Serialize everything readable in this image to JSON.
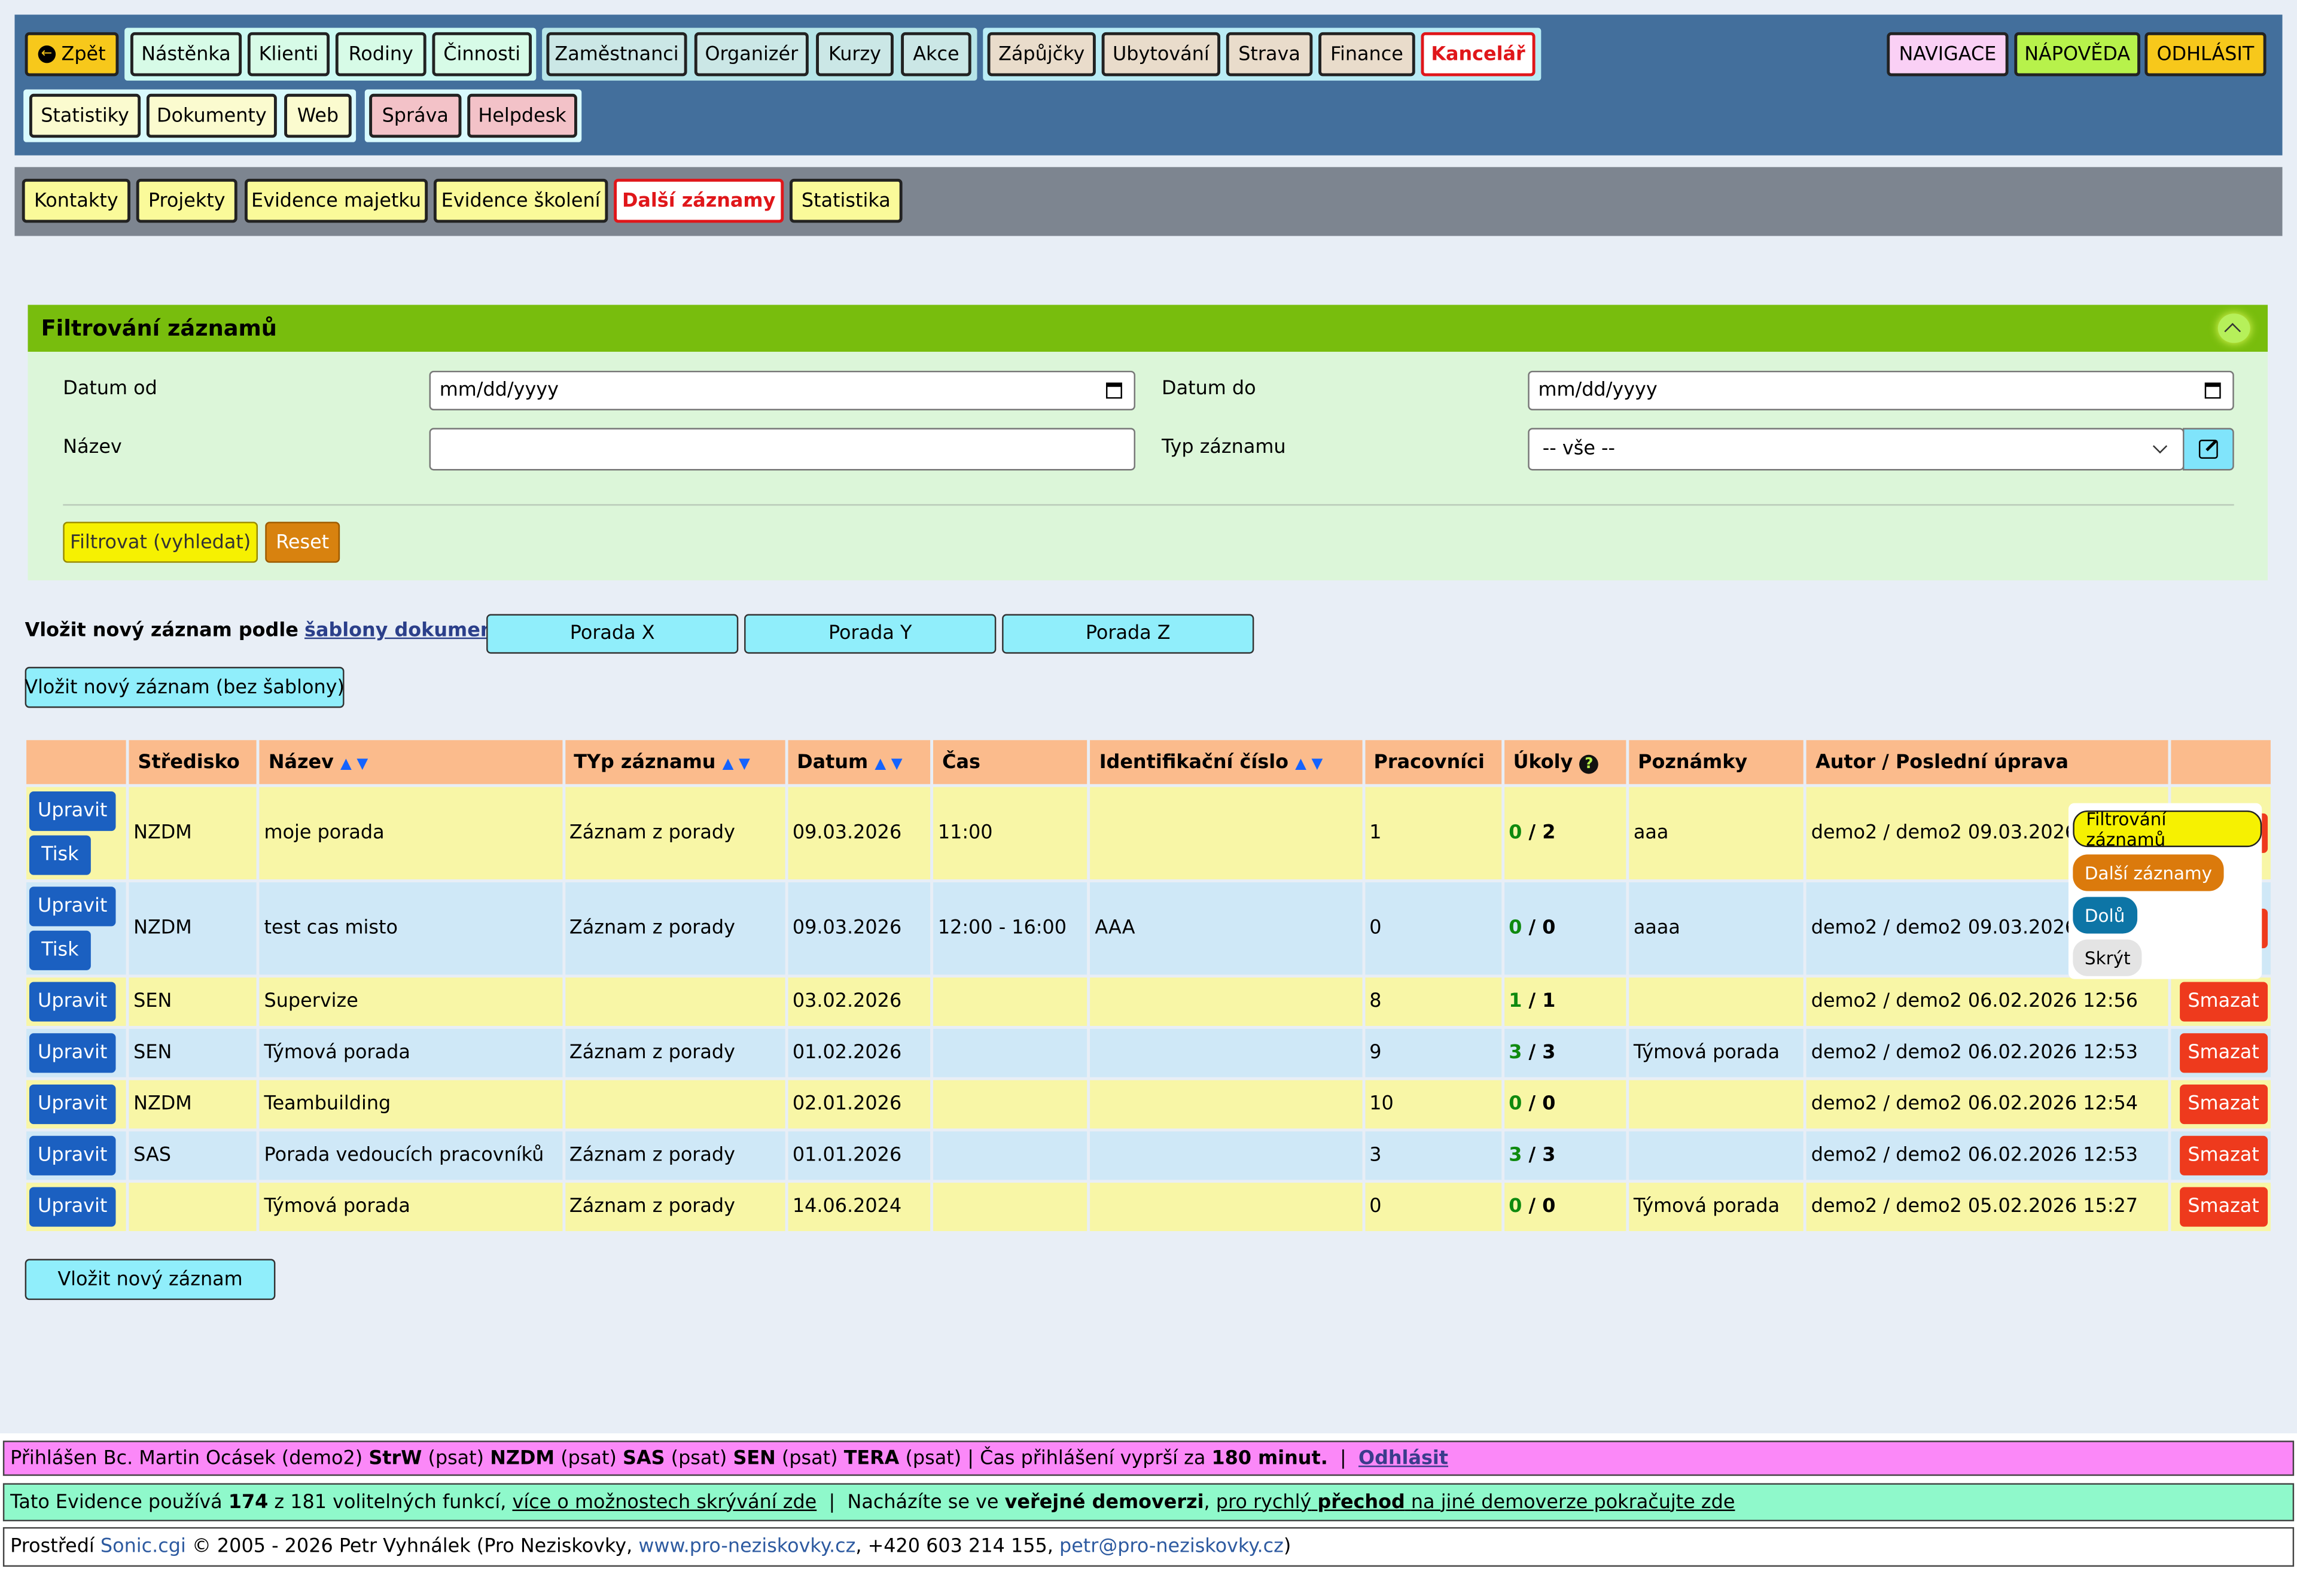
{
  "nav": {
    "back": "Zpět",
    "group1": [
      "Nástěnka",
      "Klienti",
      "Rodiny",
      "Činnosti"
    ],
    "group2": [
      "Zaměstnanci",
      "Organizér",
      "Kurzy",
      "Akce"
    ],
    "group3": [
      "Zápůjčky",
      "Ubytování",
      "Strava",
      "Finance"
    ],
    "active": "Kancelář",
    "group4": [
      "Statistiky",
      "Dokumenty",
      "Web"
    ],
    "group5": [
      "Správa",
      "Helpdesk"
    ],
    "right": [
      "NAVIGACE",
      "NÁPOVĚDA",
      "ODHLÁSIT"
    ]
  },
  "subnav": {
    "items": [
      "Kontakty",
      "Projekty",
      "Evidence majetku",
      "Evidence školení"
    ],
    "active": "Další záznamy",
    "last": "Statistika"
  },
  "filter": {
    "title": "Filtrování záznamů",
    "date_from_label": "Datum od",
    "date_to_label": "Datum do",
    "date_placeholder": "mm/dd/yyyy",
    "name_label": "Název",
    "type_label": "Typ záznamu",
    "type_value": "-- vše --",
    "filter_button": "Filtrovat (vyhledat)",
    "reset_button": "Reset"
  },
  "templates": {
    "prefix": "Vložit nový záznam podle",
    "link": "šablony dokumentů",
    "suffix": ":",
    "buttons": [
      "Porada X",
      "Porada Y",
      "Porada Z"
    ],
    "no_template": "Vložit nový záznam (bez šablony)"
  },
  "table": {
    "headers": [
      "",
      "Středisko",
      "Název",
      "TYp záznamu",
      "Datum",
      "Čas",
      "Identifikační číslo",
      "Pracovníci",
      "Úkoly",
      "Poznámky",
      "Autor / Poslední úprava",
      ""
    ],
    "edit": "Upravit",
    "print": "Tisk",
    "delete": "Smazat",
    "rows": [
      {
        "stredisko": "NZDM",
        "nazev": "moje porada",
        "typ": "Záznam z porady",
        "datum": "09.03.2026",
        "cas": "11:00",
        "id": "",
        "prac": "1",
        "done": "0",
        "total": "2",
        "pozn": "aaa",
        "autor": "demo2 / demo2 09.03.2026 0",
        "print": true
      },
      {
        "stredisko": "NZDM",
        "nazev": "test cas misto",
        "typ": "Záznam z porady",
        "datum": "09.03.2026",
        "cas": "12:00 - 16:00",
        "id": "AAA",
        "prac": "0",
        "done": "0",
        "total": "0",
        "pozn": "aaaa",
        "autor": "demo2 / demo2 09.03.2026 0",
        "print": true
      },
      {
        "stredisko": "SEN",
        "nazev": "Supervize",
        "typ": "",
        "datum": "03.02.2026",
        "cas": "",
        "id": "",
        "prac": "8",
        "done": "1",
        "total": "1",
        "pozn": "",
        "autor": "demo2 / demo2 06.02.2026 12:56",
        "print": false
      },
      {
        "stredisko": "SEN",
        "nazev": "Týmová porada",
        "typ": "Záznam z porady",
        "datum": "01.02.2026",
        "cas": "",
        "id": "",
        "prac": "9",
        "done": "3",
        "total": "3",
        "pozn": "Týmová porada",
        "autor": "demo2 / demo2 06.02.2026 12:53",
        "print": false
      },
      {
        "stredisko": "NZDM",
        "nazev": "Teambuilding",
        "typ": "",
        "datum": "02.01.2026",
        "cas": "",
        "id": "",
        "prac": "10",
        "done": "0",
        "total": "0",
        "pozn": "",
        "autor": "demo2 / demo2 06.02.2026 12:54",
        "print": false
      },
      {
        "stredisko": "SAS",
        "nazev": "Porada vedoucích pracovníků",
        "typ": "Záznam z porady",
        "datum": "01.01.2026",
        "cas": "",
        "id": "",
        "prac": "3",
        "done": "3",
        "total": "3",
        "pozn": "",
        "autor": "demo2 / demo2 06.02.2026 12:53",
        "print": false
      },
      {
        "stredisko": "",
        "nazev": "Týmová porada",
        "typ": "Záznam z porady",
        "datum": "14.06.2024",
        "cas": "",
        "id": "",
        "prac": "0",
        "done": "0",
        "total": "0",
        "pozn": "Týmová porada",
        "autor": "demo2 / demo2 05.02.2026 15:27",
        "print": false
      }
    ]
  },
  "new_record": "Vložit nový záznam",
  "popup": {
    "items": [
      "Filtrování záznamů",
      "Další záznamy",
      "Dolů",
      "Skrýt"
    ]
  },
  "footer": {
    "line1_prefix": "Přihlášen Bc. Martin Ocásek (demo2)",
    "line1_org": [
      {
        "code": "StrW",
        "note": "(psat)"
      },
      {
        "code": "NZDM",
        "note": "(psat)"
      },
      {
        "code": "SAS",
        "note": "(psat)"
      },
      {
        "code": "SEN",
        "note": "(psat)"
      },
      {
        "code": "TERA",
        "note": "(psat)"
      }
    ],
    "line1_sep": "|",
    "line1_expire_prefix": "Čas přihlášení vyprší za",
    "line1_expire_value": "180 minut.",
    "line1_logout": "Odhlásit",
    "line2_a": "Tato Evidence používá",
    "line2_count": "174",
    "line2_b": "z 181 volitelných funkcí,",
    "line2_link1": "více o možnostech skrývání zde",
    "line2_c": "Nacházíte se ve",
    "line2_bold": "veřejné demoverzi",
    "line2_d_prefix": ",",
    "line2_link2a": "pro rychlý",
    "line2_link2b": "přechod",
    "line2_link2c": "na jiné demoverze pokračujte zde",
    "line3_a": "Prostředí",
    "line3_sonic": "Sonic.cgi",
    "line3_b": "© 2005 - 2026 Petr Vyhnálek (Pro Neziskovky,",
    "line3_web": "www.pro-neziskovky.cz",
    "line3_c": ", +420 603 214 155,",
    "line3_mail": "petr@pro-neziskovky.cz",
    "line3_d": ")"
  },
  "colors": {
    "topbar": "#436f9c",
    "subbar": "#7d8590",
    "filter_header": "#78bd0d",
    "edit_button": "#1b60c1",
    "delete_button": "#ee3a1d",
    "active_tab": "#e0161a"
  }
}
